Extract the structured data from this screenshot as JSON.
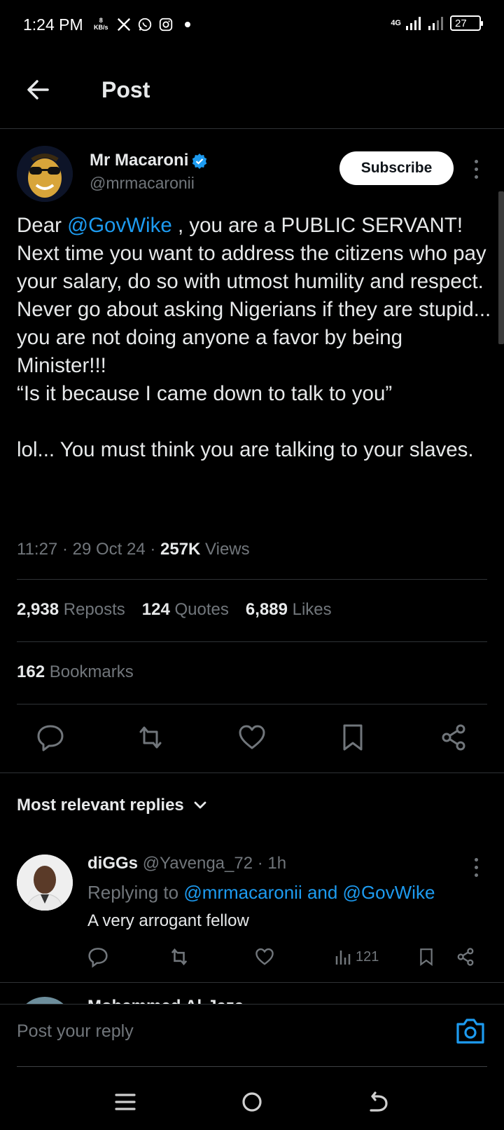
{
  "status_bar": {
    "time": "1:24 PM",
    "speed_value": "8",
    "speed_unit": "KB/s",
    "network": "4G",
    "battery": "27",
    "icons": [
      "x-icon",
      "whatsapp-icon",
      "instagram-icon",
      "dot-icon"
    ]
  },
  "header": {
    "title": "Post"
  },
  "author": {
    "name": "Mr Macaroni",
    "handle": "@mrmacaronii",
    "verified": true,
    "subscribe_label": "Subscribe"
  },
  "tweet": {
    "mention": "@GovWike",
    "line1_prefix": "Dear ",
    "line1_suffix": " , you are a PUBLIC SERVANT!",
    "paragraphs": [
      "Next time you want to address the citizens who pay your salary, do so with utmost humility and respect.",
      "Never go about asking Nigerians if they are stupid... you are not doing anyone a favor by being Minister!!!",
      "“Is it because I came down to talk to you”",
      "",
      "lol... You must think you are talking to your slaves."
    ],
    "time": "11:27",
    "date": "29 Oct 24",
    "views_count": "257K",
    "views_label": "Views"
  },
  "stats": {
    "reposts_count": "2,938",
    "reposts_label": "Reposts",
    "quotes_count": "124",
    "quotes_label": "Quotes",
    "likes_count": "6,889",
    "likes_label": "Likes",
    "bookmarks_count": "162",
    "bookmarks_label": "Bookmarks"
  },
  "actions": [
    "reply-icon",
    "repost-icon",
    "like-icon",
    "bookmark-icon",
    "share-icon"
  ],
  "replies_section": {
    "label": "Most relevant replies"
  },
  "reply": {
    "name": "diGGs",
    "handle": "@Yavenga_72",
    "time": "1h",
    "replying_prefix": "Replying to ",
    "replying_targets": "@mrmacaronii and @GovWike",
    "text": "A very arrogant fellow",
    "views": "121"
  },
  "next_reply": {
    "name": "Mohammed Al-Jaza..."
  },
  "reply_bar": {
    "placeholder": "Post your reply"
  },
  "colors": {
    "accent": "#1d9bf0",
    "background": "#000000",
    "secondary_text": "#71767b"
  }
}
